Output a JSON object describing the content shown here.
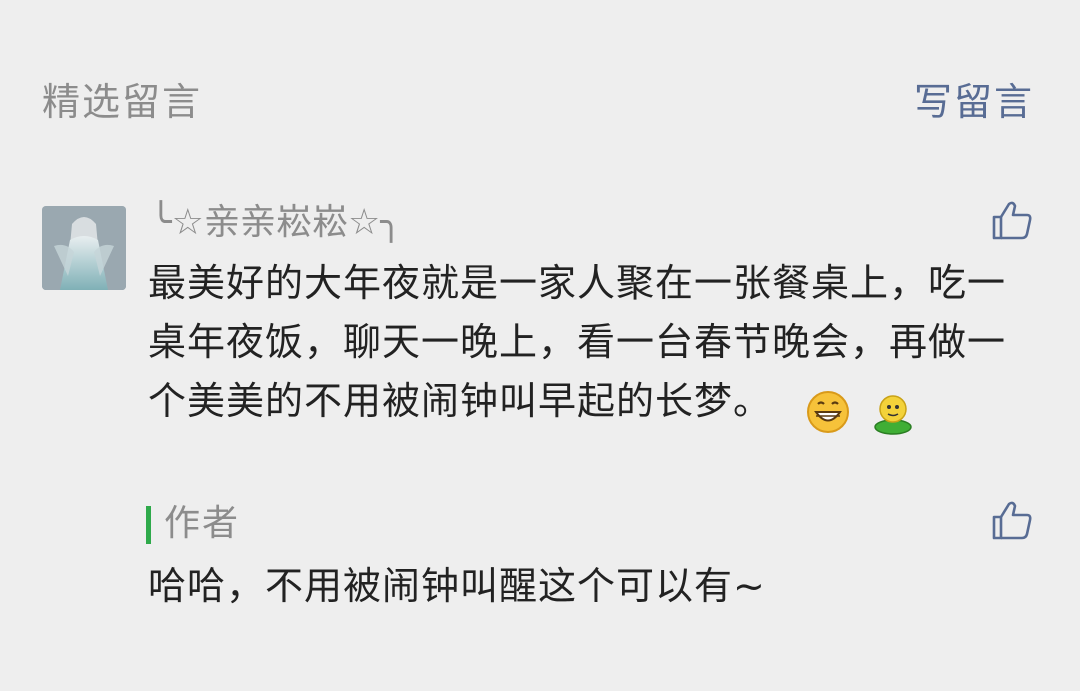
{
  "header": {
    "section_title": "精选留言",
    "write_comment_label": "写留言"
  },
  "comment": {
    "nickname": "╰☆亲亲崧崧☆╮",
    "text": "最美好的大年夜就是一家人聚在一张餐桌上，吃一桌年夜饭，聊天一晚上，看一台春节晚会，再做一个美美的不用被闹钟叫早起的长梦。",
    "emojis": [
      "grinning-face-emoji",
      "green-sprout-emoji"
    ]
  },
  "reply": {
    "author_label": "作者",
    "text": "哈哈，不用被闹钟叫醒这个可以有~"
  },
  "colors": {
    "background": "#eeeeee",
    "muted_text": "#8c8c8c",
    "link": "#586c94",
    "author_bar": "#2ea94a",
    "body_text": "#222222"
  },
  "icons": {
    "like": "thumbs-up-icon"
  }
}
